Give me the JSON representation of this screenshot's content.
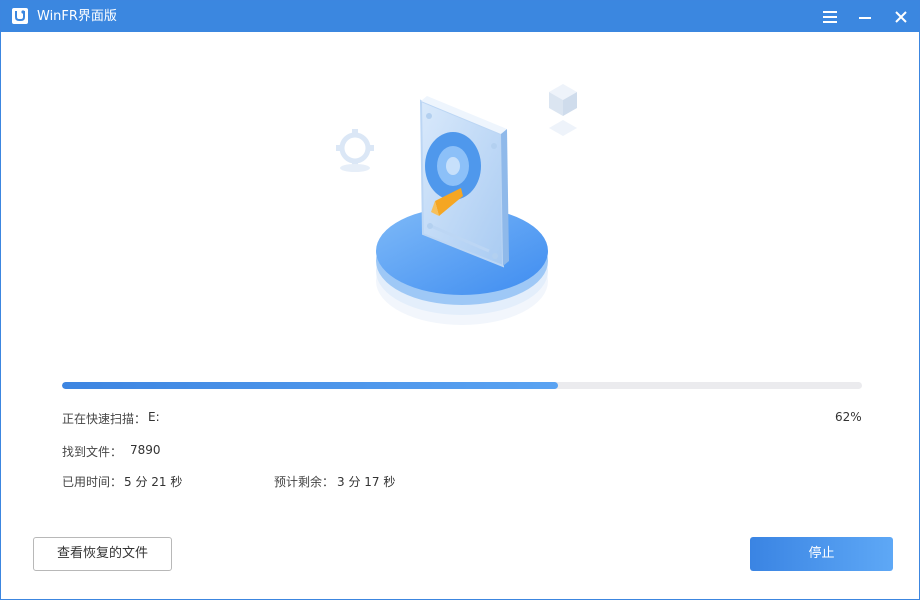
{
  "window": {
    "title": "WinFR界面版"
  },
  "titlebar": {
    "menu_icon": "hamburger-menu-icon",
    "minimize_icon": "minimize-icon",
    "close_icon": "close-icon"
  },
  "illustration": {
    "icon": "hard-drive-scan-illustration"
  },
  "scan": {
    "status_label": "正在快速扫描：",
    "drive": "E:",
    "percent_text": "62%",
    "progress": 0.62,
    "found_label": "找到文件：",
    "found_count": "7890",
    "elapsed_label": "已用时间：",
    "elapsed_value": "5 分 21 秒",
    "remaining_label": "预计剩余：",
    "remaining_value": "3 分 17 秒"
  },
  "footer": {
    "view_recovered_label": "查看恢复的文件",
    "stop_label": "停止"
  },
  "colors": {
    "accent": "#3b87e0",
    "progress_track": "#ebebee",
    "secondary_border": "#b8b8b8"
  }
}
